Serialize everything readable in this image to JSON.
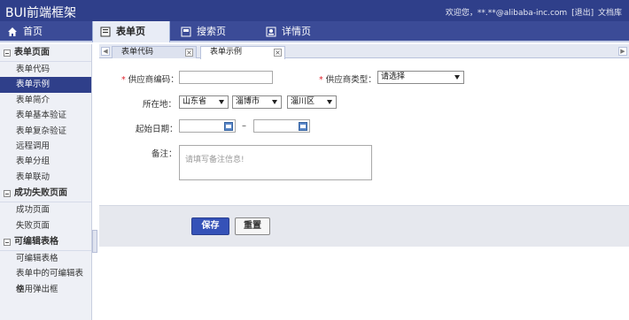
{
  "app": {
    "title": "BUI前端框架"
  },
  "user": {
    "welcome": "欢迎您，**.**@alibaba-inc.com",
    "logout": "[退出]",
    "docs": "文档库"
  },
  "nav": {
    "tabs": [
      {
        "label": "首页",
        "icon": "home-icon"
      },
      {
        "label": "表单页",
        "icon": "form-icon"
      },
      {
        "label": "搜索页",
        "icon": "search-page-icon"
      },
      {
        "label": "详情页",
        "icon": "detail-icon"
      }
    ]
  },
  "sidebar": {
    "groups": [
      {
        "title": "表单页面",
        "items": [
          "表单代码",
          "表单示例",
          "表单简介",
          "表单基本验证",
          "表单复杂验证",
          "远程调用",
          "表单分组",
          "表单联动"
        ]
      },
      {
        "title": "成功失败页面",
        "items": [
          "成功页面",
          "失败页面"
        ]
      },
      {
        "title": "可编辑表格",
        "items": [
          "可编辑表格",
          "表单中的可编辑表格",
          "使用弹出框"
        ]
      }
    ],
    "active_item": "表单示例"
  },
  "subtabs": [
    {
      "label": "表单代码"
    },
    {
      "label": "表单示例"
    }
  ],
  "form": {
    "supplier_code_label": "供应商编码：",
    "supplier_type_label": "供应商类型：",
    "supplier_type_value": "请选择",
    "location_label": "所在地：",
    "province": "山东省",
    "city": "淄博市",
    "district": "淄川区",
    "start_date_label": "起始日期：",
    "date_separator": "–",
    "note_label": "备注：",
    "note_placeholder": "请填写备注信息!",
    "required_mark": "*"
  },
  "buttons": {
    "save": "保存",
    "reset": "重置"
  },
  "colors": {
    "topbar": "#2f3f8a",
    "nav": "#3b4b97",
    "primary": "#3552b8",
    "required": "#e0242e"
  }
}
